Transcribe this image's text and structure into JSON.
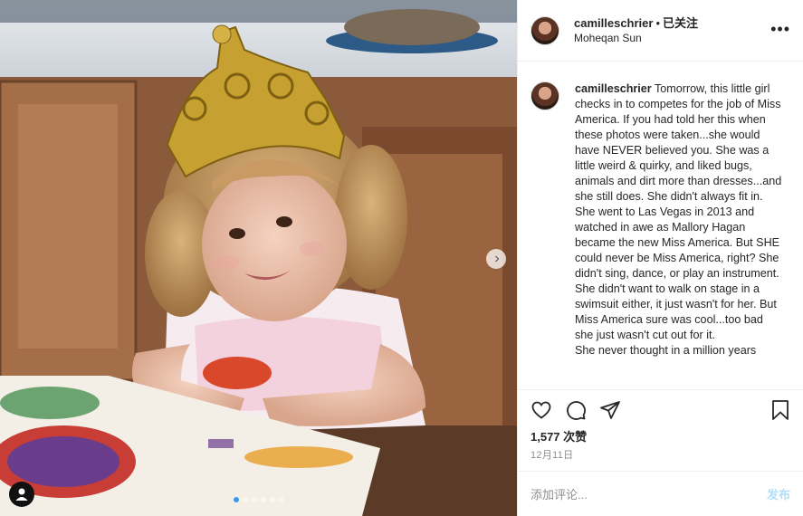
{
  "post": {
    "image_alt": "Little girl wearing a gold crown at a table",
    "carousel_next": "›",
    "carousel_dots": 6,
    "carousel_active": 1
  },
  "header": {
    "username": "camilleschrier",
    "separator": "•",
    "follow_label": "已关注",
    "location": "Moheqan Sun",
    "more_label": "•••"
  },
  "caption": {
    "username": "camilleschrier",
    "text": "Tomorrow, this little girl checks in to competes for the job of Miss America. If you had told her this when these photos were taken...she would have NEVER believed you. She was a little weird & quirky, and liked bugs, animals and dirt more than dresses...and she still does. She didn't always fit in.\nShe went to Las Vegas in 2013 and watched in awe as Mallory Hagan became the new Miss America. But SHE could never be Miss America, right? She didn't sing, dance, or play an instrument. She didn't want to walk on stage in a swimsuit either, it just wasn't for her. But Miss America sure was cool...too bad she just wasn't cut out for it.\nShe never thought in a million years"
  },
  "actions": {
    "like_icon": "heart-icon",
    "comment_icon": "comment-icon",
    "share_icon": "share-icon",
    "save_icon": "bookmark-icon"
  },
  "likes": "1,577 次赞",
  "date": "12月11日",
  "comment_box": {
    "placeholder": "添加评论...",
    "post_label": "发布"
  },
  "colors": {
    "link_disabled": "#b2dffc",
    "active_dot": "#3897f0",
    "muted": "#8e8e8e"
  }
}
